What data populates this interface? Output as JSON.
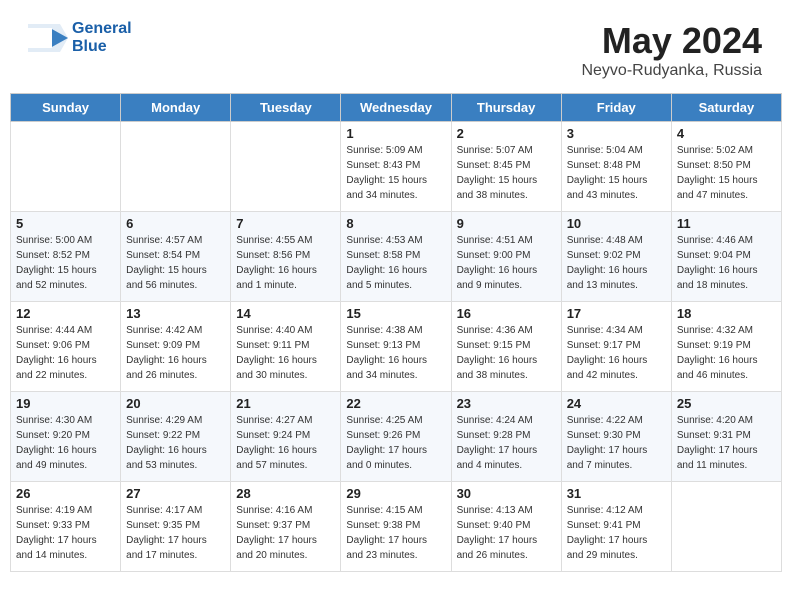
{
  "header": {
    "logo_line1": "General",
    "logo_line2": "Blue",
    "title": "May 2024",
    "location": "Neyvo-Rudyanka, Russia"
  },
  "days_of_week": [
    "Sunday",
    "Monday",
    "Tuesday",
    "Wednesday",
    "Thursday",
    "Friday",
    "Saturday"
  ],
  "weeks": [
    [
      {
        "day": "",
        "detail": ""
      },
      {
        "day": "",
        "detail": ""
      },
      {
        "day": "",
        "detail": ""
      },
      {
        "day": "1",
        "detail": "Sunrise: 5:09 AM\nSunset: 8:43 PM\nDaylight: 15 hours\nand 34 minutes."
      },
      {
        "day": "2",
        "detail": "Sunrise: 5:07 AM\nSunset: 8:45 PM\nDaylight: 15 hours\nand 38 minutes."
      },
      {
        "day": "3",
        "detail": "Sunrise: 5:04 AM\nSunset: 8:48 PM\nDaylight: 15 hours\nand 43 minutes."
      },
      {
        "day": "4",
        "detail": "Sunrise: 5:02 AM\nSunset: 8:50 PM\nDaylight: 15 hours\nand 47 minutes."
      }
    ],
    [
      {
        "day": "5",
        "detail": "Sunrise: 5:00 AM\nSunset: 8:52 PM\nDaylight: 15 hours\nand 52 minutes."
      },
      {
        "day": "6",
        "detail": "Sunrise: 4:57 AM\nSunset: 8:54 PM\nDaylight: 15 hours\nand 56 minutes."
      },
      {
        "day": "7",
        "detail": "Sunrise: 4:55 AM\nSunset: 8:56 PM\nDaylight: 16 hours\nand 1 minute."
      },
      {
        "day": "8",
        "detail": "Sunrise: 4:53 AM\nSunset: 8:58 PM\nDaylight: 16 hours\nand 5 minutes."
      },
      {
        "day": "9",
        "detail": "Sunrise: 4:51 AM\nSunset: 9:00 PM\nDaylight: 16 hours\nand 9 minutes."
      },
      {
        "day": "10",
        "detail": "Sunrise: 4:48 AM\nSunset: 9:02 PM\nDaylight: 16 hours\nand 13 minutes."
      },
      {
        "day": "11",
        "detail": "Sunrise: 4:46 AM\nSunset: 9:04 PM\nDaylight: 16 hours\nand 18 minutes."
      }
    ],
    [
      {
        "day": "12",
        "detail": "Sunrise: 4:44 AM\nSunset: 9:06 PM\nDaylight: 16 hours\nand 22 minutes."
      },
      {
        "day": "13",
        "detail": "Sunrise: 4:42 AM\nSunset: 9:09 PM\nDaylight: 16 hours\nand 26 minutes."
      },
      {
        "day": "14",
        "detail": "Sunrise: 4:40 AM\nSunset: 9:11 PM\nDaylight: 16 hours\nand 30 minutes."
      },
      {
        "day": "15",
        "detail": "Sunrise: 4:38 AM\nSunset: 9:13 PM\nDaylight: 16 hours\nand 34 minutes."
      },
      {
        "day": "16",
        "detail": "Sunrise: 4:36 AM\nSunset: 9:15 PM\nDaylight: 16 hours\nand 38 minutes."
      },
      {
        "day": "17",
        "detail": "Sunrise: 4:34 AM\nSunset: 9:17 PM\nDaylight: 16 hours\nand 42 minutes."
      },
      {
        "day": "18",
        "detail": "Sunrise: 4:32 AM\nSunset: 9:19 PM\nDaylight: 16 hours\nand 46 minutes."
      }
    ],
    [
      {
        "day": "19",
        "detail": "Sunrise: 4:30 AM\nSunset: 9:20 PM\nDaylight: 16 hours\nand 49 minutes."
      },
      {
        "day": "20",
        "detail": "Sunrise: 4:29 AM\nSunset: 9:22 PM\nDaylight: 16 hours\nand 53 minutes."
      },
      {
        "day": "21",
        "detail": "Sunrise: 4:27 AM\nSunset: 9:24 PM\nDaylight: 16 hours\nand 57 minutes."
      },
      {
        "day": "22",
        "detail": "Sunrise: 4:25 AM\nSunset: 9:26 PM\nDaylight: 17 hours\nand 0 minutes."
      },
      {
        "day": "23",
        "detail": "Sunrise: 4:24 AM\nSunset: 9:28 PM\nDaylight: 17 hours\nand 4 minutes."
      },
      {
        "day": "24",
        "detail": "Sunrise: 4:22 AM\nSunset: 9:30 PM\nDaylight: 17 hours\nand 7 minutes."
      },
      {
        "day": "25",
        "detail": "Sunrise: 4:20 AM\nSunset: 9:31 PM\nDaylight: 17 hours\nand 11 minutes."
      }
    ],
    [
      {
        "day": "26",
        "detail": "Sunrise: 4:19 AM\nSunset: 9:33 PM\nDaylight: 17 hours\nand 14 minutes."
      },
      {
        "day": "27",
        "detail": "Sunrise: 4:17 AM\nSunset: 9:35 PM\nDaylight: 17 hours\nand 17 minutes."
      },
      {
        "day": "28",
        "detail": "Sunrise: 4:16 AM\nSunset: 9:37 PM\nDaylight: 17 hours\nand 20 minutes."
      },
      {
        "day": "29",
        "detail": "Sunrise: 4:15 AM\nSunset: 9:38 PM\nDaylight: 17 hours\nand 23 minutes."
      },
      {
        "day": "30",
        "detail": "Sunrise: 4:13 AM\nSunset: 9:40 PM\nDaylight: 17 hours\nand 26 minutes."
      },
      {
        "day": "31",
        "detail": "Sunrise: 4:12 AM\nSunset: 9:41 PM\nDaylight: 17 hours\nand 29 minutes."
      },
      {
        "day": "",
        "detail": ""
      }
    ]
  ]
}
